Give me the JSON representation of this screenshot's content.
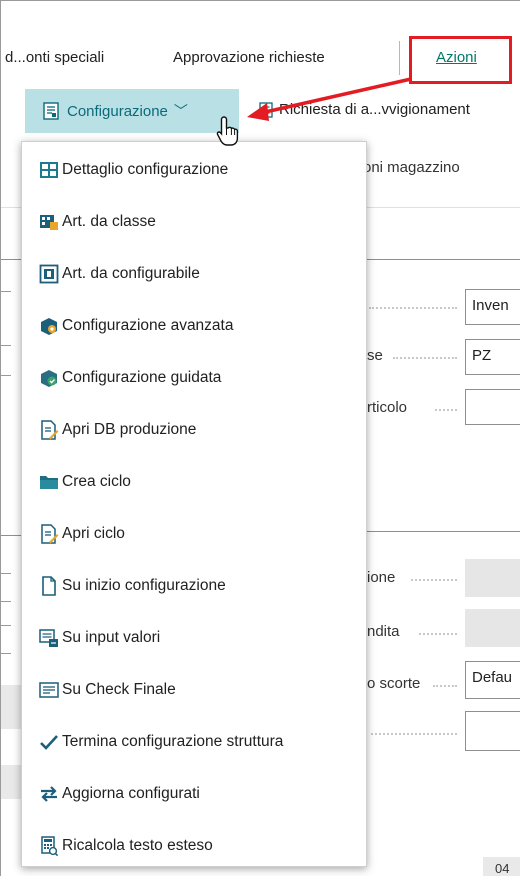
{
  "topbar": {
    "item1": "d...onti speciali",
    "item2": "Approvazione richieste",
    "azioni": "Azioni"
  },
  "toolbar": {
    "configurazione_label": "Configurazione",
    "richiesta_label": "Richiesta di a...vvigionament"
  },
  "background": {
    "magazzino_text": "oni magazzino",
    "inven_value": "Inven",
    "se_label": "se",
    "pz_value": "PZ",
    "articolo_label": "rticolo",
    "ione_label": "ione",
    "ndita_label": "ndita",
    "scorte_label": "o scorte",
    "defau_value": "Defau",
    "bottom_fragment": "04"
  },
  "menu": {
    "items": [
      {
        "label": "Dettaglio configurazione",
        "icon": "config-detail-icon"
      },
      {
        "label": "Art. da classe",
        "icon": "class-item-icon"
      },
      {
        "label": "Art. da configurabile",
        "icon": "configurable-item-icon"
      },
      {
        "label": "Configurazione avanzata",
        "icon": "advanced-config-icon"
      },
      {
        "label": "Configurazione guidata",
        "icon": "guided-config-icon"
      },
      {
        "label": "Apri DB produzione",
        "icon": "open-bom-icon"
      },
      {
        "label": "Crea ciclo",
        "icon": "folder-icon"
      },
      {
        "label": "Apri ciclo",
        "icon": "open-routing-icon"
      },
      {
        "label": "Su inizio configurazione",
        "icon": "page-icon"
      },
      {
        "label": "Su input valori",
        "icon": "input-values-icon"
      },
      {
        "label": "Su Check Finale",
        "icon": "final-check-icon"
      },
      {
        "label": "Termina configurazione struttura",
        "icon": "checkmark-icon"
      },
      {
        "label": "Aggiorna configurati",
        "icon": "refresh-arrows-icon"
      },
      {
        "label": "Ricalcola testo esteso",
        "icon": "calculator-icon"
      }
    ]
  },
  "colors": {
    "accent": "#00796b",
    "button_bg": "#b9e0e5",
    "highlight_red": "#e31b23"
  }
}
